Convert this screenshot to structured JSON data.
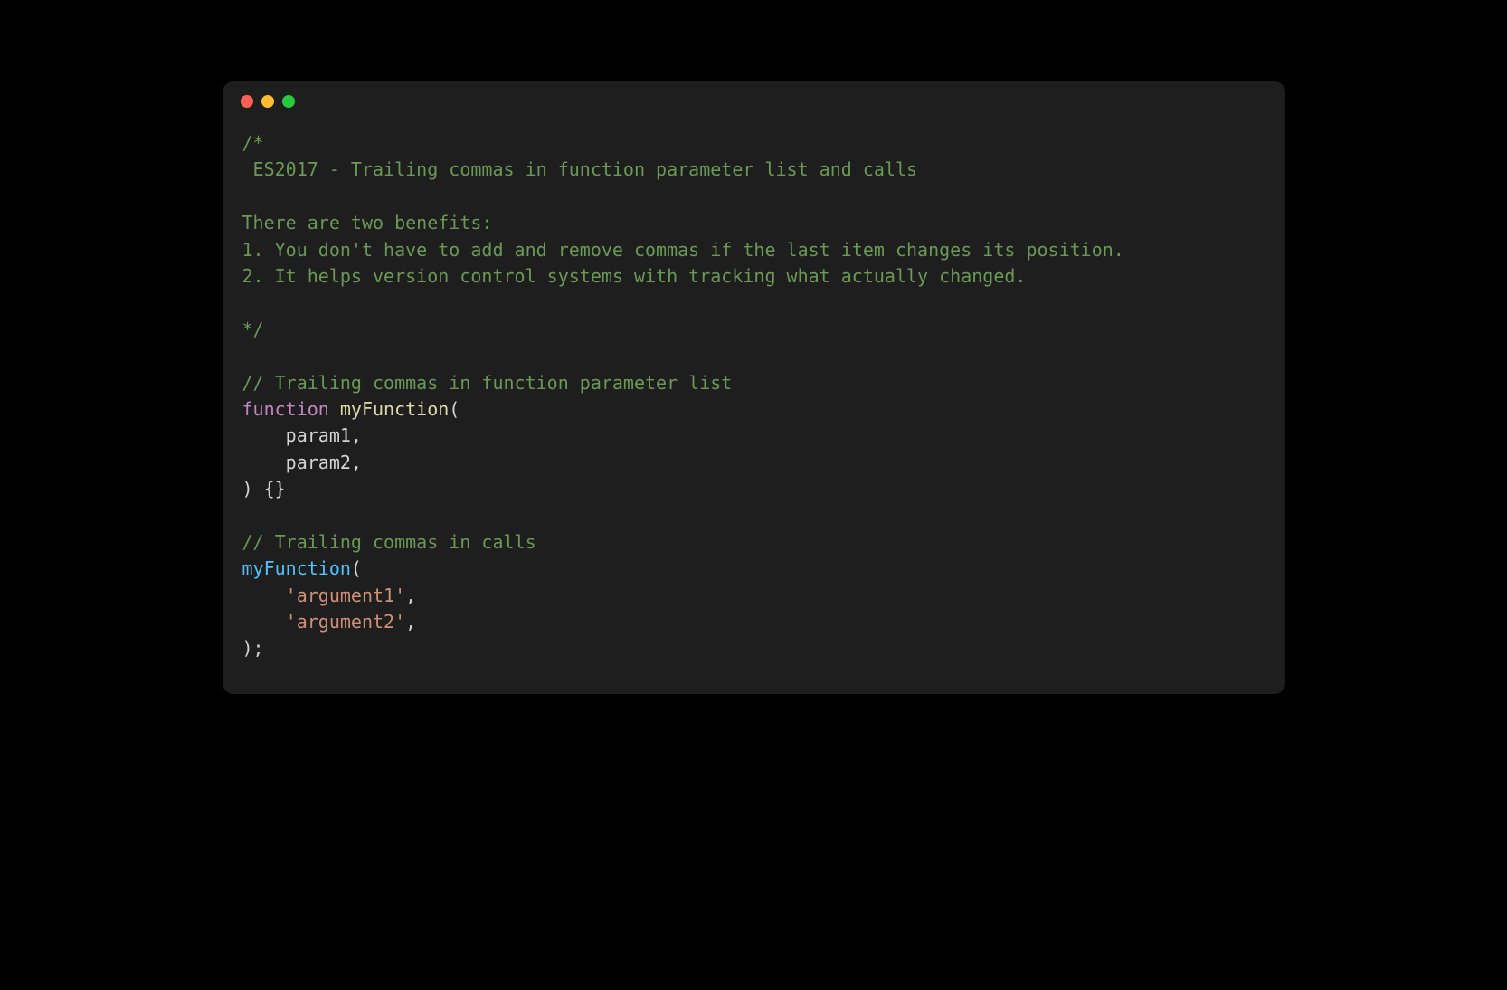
{
  "window": {
    "traffic_lights": {
      "close": "close",
      "minimize": "minimize",
      "zoom": "zoom"
    }
  },
  "code": {
    "block_comment_open": "/*",
    "block_comment_l1": " ES2017 - Trailing commas in function parameter list and calls",
    "block_comment_l2": "",
    "block_comment_l3": "There are two benefits:",
    "block_comment_l4": "1. You don't have to add and remove commas if the last item changes its position.",
    "block_comment_l5": "2. It helps version control systems with tracking what actually changed.",
    "block_comment_l6": "",
    "block_comment_close": "*/",
    "line_comment_1": "// Trailing commas in function parameter list",
    "kw_function": "function",
    "fn_name": "myFunction",
    "paren_open": "(",
    "indent": "    ",
    "param1": "param1",
    "param2": "param2",
    "comma": ",",
    "paren_close_body": ") {}",
    "line_comment_2": "// Trailing commas in calls",
    "fn_call": "myFunction",
    "call_paren_open": "(",
    "arg1": "'argument1'",
    "arg2": "'argument2'",
    "call_close": ");"
  }
}
